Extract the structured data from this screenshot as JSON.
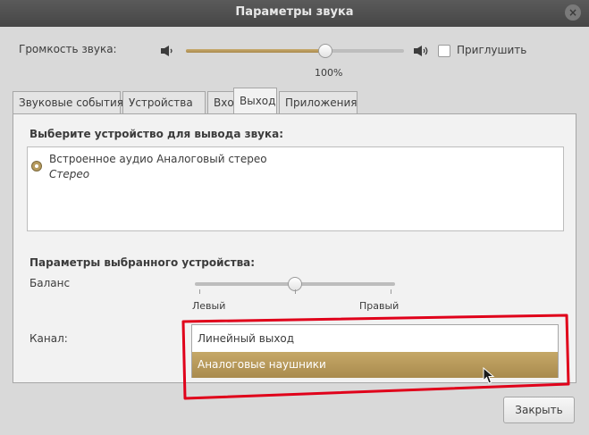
{
  "window": {
    "title": "Параметры звука"
  },
  "volume": {
    "label": "Громкость звука:",
    "value_text": "100%",
    "level": 1.0,
    "mute_label": "Приглушить"
  },
  "tabs": [
    {
      "label": "Звуковые события"
    },
    {
      "label": "Устройства"
    },
    {
      "label": "Вход"
    },
    {
      "label": "Выход",
      "active": true
    },
    {
      "label": "Приложения"
    }
  ],
  "output": {
    "select_heading": "Выберите устройство для вывода звука:",
    "device": {
      "name": "Встроенное аудио Аналоговый стерео",
      "profile": "Стерео",
      "selected": true
    },
    "settings_heading": "Параметры выбранного устройства:",
    "balance": {
      "label": "Баланс",
      "left_label": "Левый",
      "right_label": "Правый",
      "value": 0.5
    },
    "channel": {
      "label": "Канал:",
      "options": [
        "Линейный выход",
        "Аналоговые наушники"
      ],
      "highlighted_index": 1
    }
  },
  "footer": {
    "close_label": "Закрыть"
  },
  "colors": {
    "accent": "#b39757",
    "annotation": "#e0001a",
    "titlebar": "#4f4f4f"
  },
  "icons": [
    "speaker-low-icon",
    "speaker-high-icon",
    "window-close-icon",
    "mouse-cursor-icon"
  ]
}
